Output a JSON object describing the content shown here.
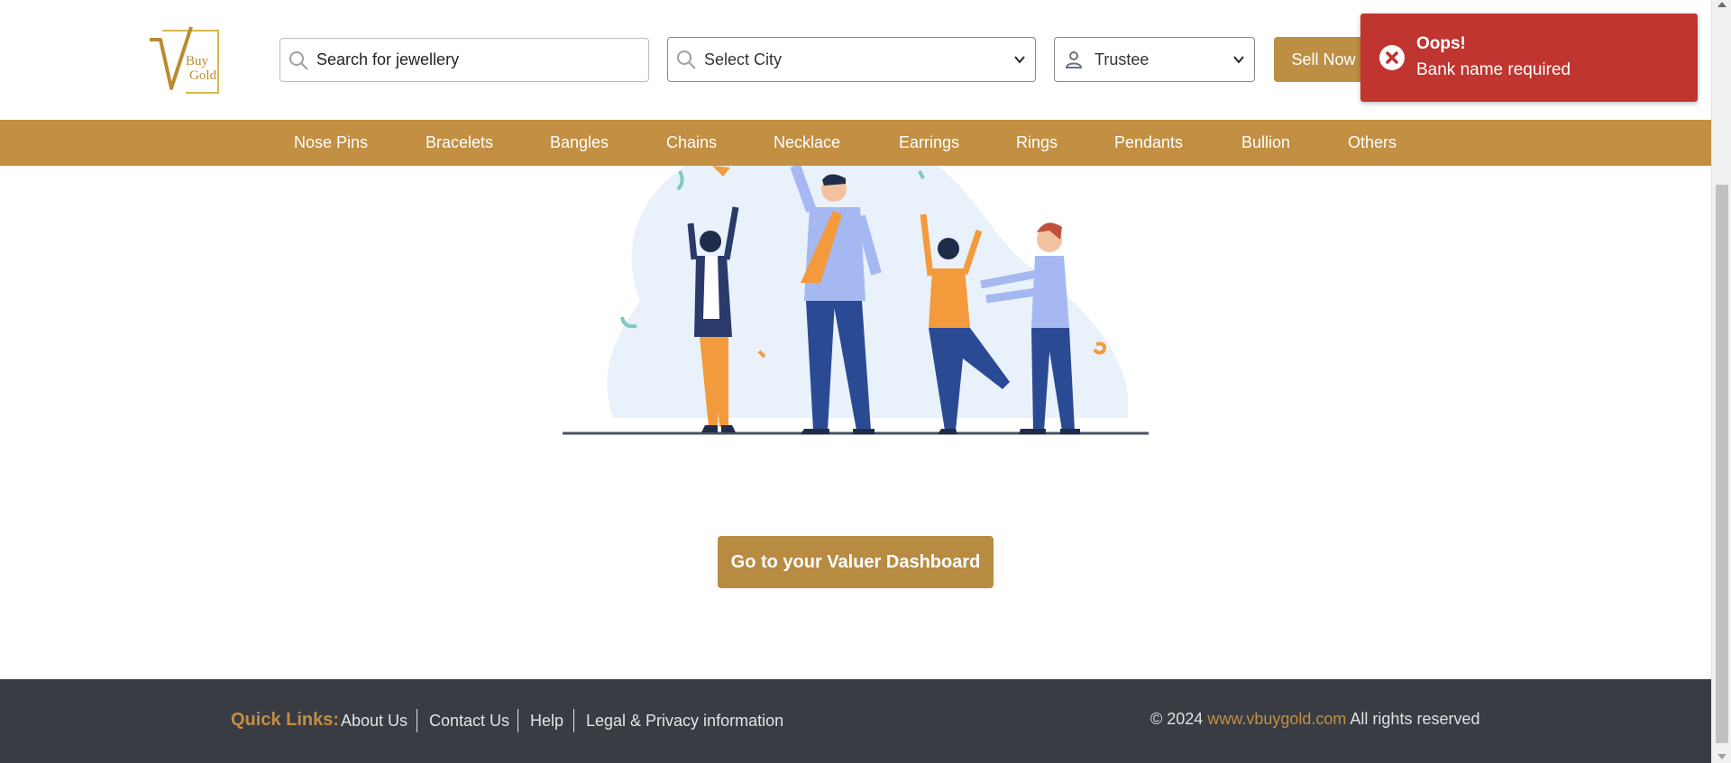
{
  "header": {
    "logo_text_top": "Buy",
    "logo_text_bottom": "Gold",
    "search_placeholder": "Search for jewellery",
    "city_select": "Select City",
    "role_select": "Trustee",
    "sell_label": "Sell Now"
  },
  "nav": {
    "items": [
      "Nose Pins",
      "Bracelets",
      "Bangles",
      "Chains",
      "Necklace",
      "Earrings",
      "Rings",
      "Pendants",
      "Bullion",
      "Others"
    ]
  },
  "main": {
    "dashboard_button": "Go to your Valuer Dashboard"
  },
  "footer": {
    "quick_links_label": "Quick Links:",
    "links": [
      "About Us",
      "Contact Us",
      "Help",
      "Legal & Privacy information"
    ],
    "copyright_prefix": "© 2024",
    "site": "www.vbuygold.com",
    "copyright_suffix": "All rights reserved"
  },
  "toast": {
    "title": "Oops!",
    "message": "Bank name required",
    "icon": "error-circle-icon"
  },
  "colors": {
    "brand_gold": "#c28f43",
    "button_gold": "#b88b43",
    "footer_bg": "#393c43",
    "toast_red": "#c0352f"
  }
}
